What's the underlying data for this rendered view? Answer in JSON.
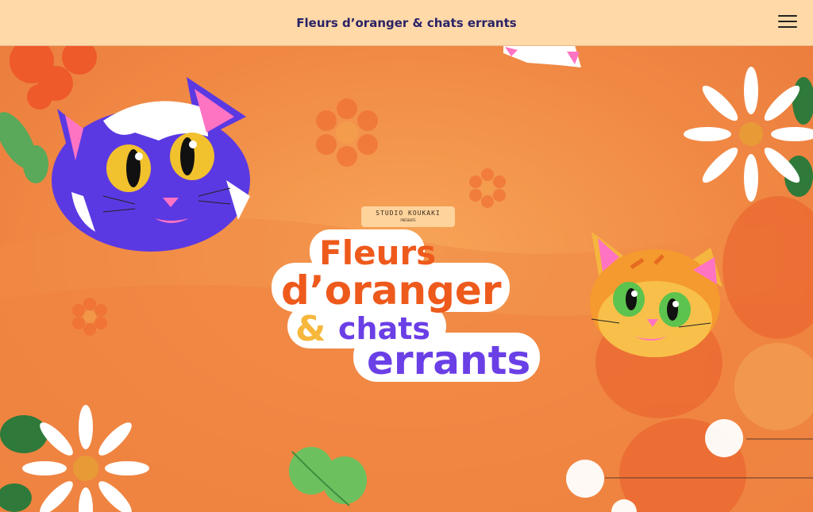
{
  "header": {
    "title": "Fleurs d’oranger & chats errants",
    "menu_icon": "hamburger-icon"
  },
  "hero": {
    "studio": "STUDIO KOUKAKI",
    "presente": "PRÉSENTE",
    "title_line1": "Fleurs",
    "title_line2": "d’oranger",
    "title_amp": "&",
    "title_line3": "chats",
    "title_line4": "errants"
  },
  "colors": {
    "header_bg": "#FFD9A8",
    "header_text": "#2A2266",
    "background_orange": "#F18A45",
    "title_orange": "#EE5A1C",
    "title_purple": "#6A3FE6",
    "ampersand_yellow": "#F6B73C"
  }
}
